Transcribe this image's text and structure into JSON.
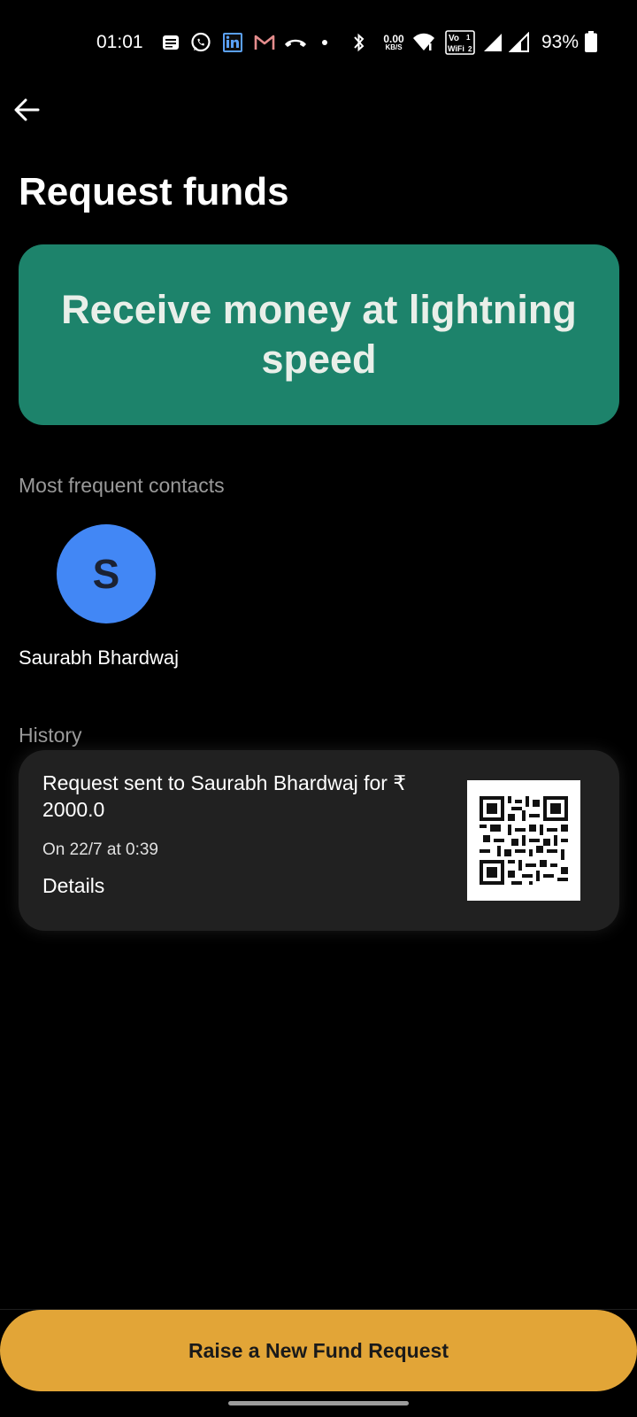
{
  "status_bar": {
    "time": "01:01",
    "net_speed_value": "0.00",
    "net_speed_unit": "KB/S",
    "vowifi_line1": "Vo",
    "vowifi_line2": "WiFi",
    "battery": "93%",
    "icons": [
      "message-icon",
      "whatsapp-icon",
      "linkedin-icon",
      "gmail-icon",
      "call-icon",
      "dot-icon",
      "bluetooth-icon",
      "wifi-icon",
      "vowifi-icon",
      "signal-icon",
      "signal-icon",
      "battery-icon"
    ]
  },
  "header": {
    "back_icon": "arrow-left-icon",
    "title": "Request funds"
  },
  "banner": {
    "text": "Receive money at lightning speed",
    "color": "#1d836b"
  },
  "frequent_contacts": {
    "label": "Most frequent contacts",
    "items": [
      {
        "initial": "S",
        "name": "Saurabh Bhardwaj",
        "avatar_color": "#4287f5"
      }
    ]
  },
  "history": {
    "label": "History",
    "items": [
      {
        "text": "Request sent to Saurabh Bhardwaj for ₹ 2000.0",
        "date": "On 22/7 at 0:39",
        "details_label": "Details",
        "qr_icon": "qr-code-icon"
      }
    ]
  },
  "footer": {
    "button_label": "Raise a New Fund Request",
    "button_color": "#e2a537"
  }
}
